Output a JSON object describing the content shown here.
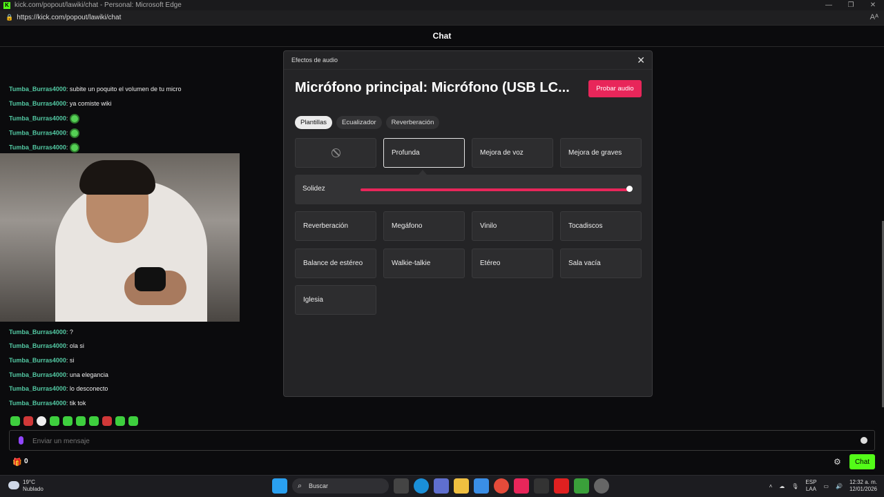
{
  "browser": {
    "title": "kick.com/popout/lawiki/chat - Personal: Microsoft Edge",
    "url": "https://kick.com/popout/lawiki/chat"
  },
  "chat": {
    "header": "Chat",
    "messages_top": [
      {
        "user": "Tumba_Burras4000",
        "text": ": subite un poquito el volumen de tu micro"
      },
      {
        "user": "Tumba_Burras4000",
        "text": ": ya comiste wiki"
      },
      {
        "user": "Tumba_Burras4000",
        "text": ":"
      },
      {
        "user": "Tumba_Burras4000",
        "text": ":"
      },
      {
        "user": "Tumba_Burras4000",
        "text": ":"
      }
    ],
    "messages_bottom": [
      {
        "user": "Tumba_Burras4000",
        "text": ": ?"
      },
      {
        "user": "Tumba_Burras4000",
        "text": ": ola si"
      },
      {
        "user": "Tumba_Burras4000",
        "text": ": si"
      },
      {
        "user": "Tumba_Burras4000",
        "text": ": una elegancia"
      },
      {
        "user": "Tumba_Burras4000",
        "text": ": lo desconecto"
      },
      {
        "user": "Tumba_Burras4000",
        "text": ": tik tok"
      }
    ],
    "input_placeholder": "Enviar un mensaje",
    "gift_count": "0",
    "send_label": "Chat",
    "accent_color": "#53fc18",
    "username_color": "#53c9a3"
  },
  "modal": {
    "header": "Efectos de audio",
    "title": "Micrófono principal: Micrófono (USB LC...",
    "test_button": "Probar audio",
    "tabs": [
      "Plantillas",
      "Ecualizador",
      "Reverberación"
    ],
    "presets_row1": [
      "",
      "Profunda",
      "Mejora de voz",
      "Mejora de graves"
    ],
    "slider_label": "Solidez",
    "slider_value": 1.0,
    "presets_row2": [
      "Reverberación",
      "Megáfono",
      "Vinilo",
      "Tocadiscos"
    ],
    "presets_row3": [
      "Balance de estéreo",
      "Walkie-talkie",
      "Etéreo",
      "Sala vacía"
    ],
    "presets_row4": [
      "Iglesia"
    ],
    "accent_color": "#e8265a"
  },
  "taskbar": {
    "temperature": "19°C",
    "weather": "Nublado",
    "search": "Buscar",
    "lang1": "ESP",
    "lang2": "LAA",
    "time": "12:32 a. m.",
    "date": "12/01/2026"
  }
}
